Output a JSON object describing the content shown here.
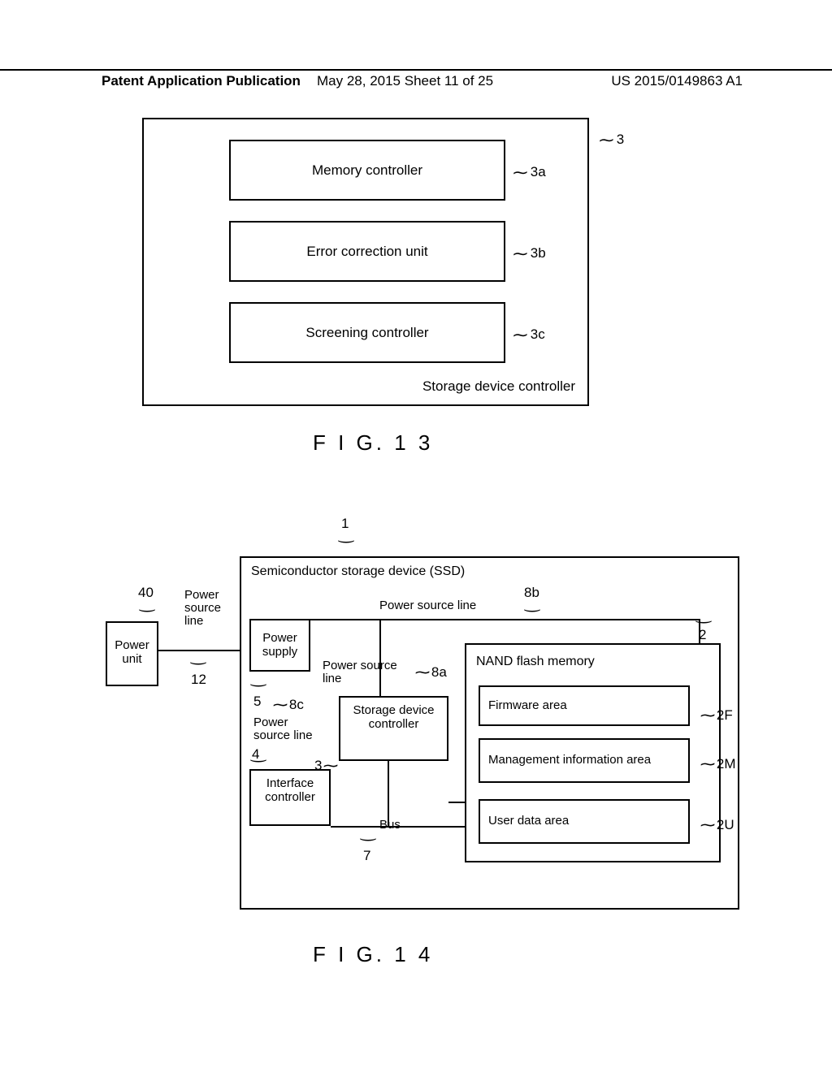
{
  "header": {
    "left": "Patent Application Publication",
    "center": "May 28, 2015  Sheet 11 of 25",
    "right": "US 2015/0149863 A1"
  },
  "fig13": {
    "box1": "Memory controller",
    "box2": "Error correction unit",
    "box3": "Screening controller",
    "bottom_label": "Storage device controller",
    "ref1": "3a",
    "ref2": "3b",
    "ref3": "3c",
    "ref_outer": "3",
    "caption": "F I G. 1 3"
  },
  "fig14": {
    "caption": "F I G. 1 4",
    "ssd_title": "Semiconductor storage device (SSD)",
    "power_unit": "Power unit",
    "power_supply": "Power supply",
    "storage_ctrl": "Storage device controller",
    "iface_ctrl": "Interface controller",
    "nand_title": "NAND flash memory",
    "nand_box1": "Firmware area",
    "nand_box2": "Management information area",
    "nand_box3": "User data area",
    "ps_line_top": "Power source line",
    "ps_line_mid": "Power source line",
    "ps_line_left": "Power source line",
    "bus": "Bus",
    "ref": {
      "main": "1",
      "nand": "2",
      "sdc": "3",
      "ifc": "4",
      "ps": "5",
      "bus": "7",
      "psl_mid": "8a",
      "psl_top": "8b",
      "psl_left": "8c",
      "fw": "2F",
      "mi": "2M",
      "ud": "2U",
      "pu": "40",
      "psl_ext": "12"
    }
  }
}
